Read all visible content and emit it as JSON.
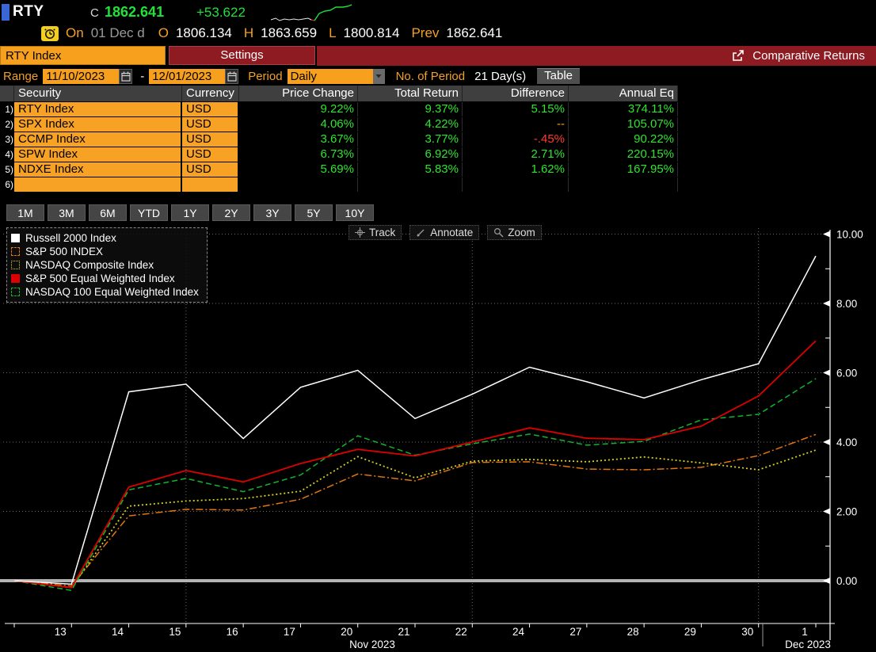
{
  "header": {
    "ticker": "RTY",
    "close_label": "C",
    "close_value": "1862.641",
    "change": "+53.622",
    "session_label": "On",
    "session_date": "01 Dec d",
    "open_label": "O",
    "open_value": "1806.134",
    "high_label": "H",
    "high_value": "1863.659",
    "low_label": "L",
    "low_value": "1800.814",
    "prev_label": "Prev",
    "prev_value": "1862.641"
  },
  "tabs": {
    "security_input": "RTY Index",
    "settings_label": "Settings",
    "title": "Comparative Returns"
  },
  "controls": {
    "range_label": "Range",
    "range_start": "11/10/2023",
    "range_separator": "-",
    "range_end": "12/01/2023",
    "period_label": "Period",
    "period_value": "Daily",
    "num_period_label": "No. of Period",
    "num_period_value": "21 Day(s)",
    "table_button": "Table"
  },
  "table": {
    "columns": [
      "Security",
      "Currency",
      "Price Change",
      "Total Return",
      "Difference",
      "Annual Eq"
    ],
    "rows": [
      {
        "num": "1)",
        "security": "RTY Index",
        "currency": "USD",
        "price_change": "9.22%",
        "total_return": "9.37%",
        "difference": "5.15%",
        "diff_color": "green",
        "annual_eq": "374.11%"
      },
      {
        "num": "2)",
        "security": "SPX Index",
        "currency": "USD",
        "price_change": "4.06%",
        "total_return": "4.22%",
        "difference": "--",
        "diff_color": "amber",
        "annual_eq": "105.07%"
      },
      {
        "num": "3)",
        "security": "CCMP Index",
        "currency": "USD",
        "price_change": "3.67%",
        "total_return": "3.77%",
        "difference": "-.45%",
        "diff_color": "red",
        "annual_eq": "90.22%"
      },
      {
        "num": "4)",
        "security": "SPW Index",
        "currency": "USD",
        "price_change": "6.73%",
        "total_return": "6.92%",
        "difference": "2.71%",
        "diff_color": "green",
        "annual_eq": "220.15%"
      },
      {
        "num": "5)",
        "security": "NDXE Index",
        "currency": "USD",
        "price_change": "5.69%",
        "total_return": "5.83%",
        "difference": "1.62%",
        "diff_color": "green",
        "annual_eq": "167.95%"
      },
      {
        "num": "6)",
        "security": "",
        "currency": "",
        "price_change": "",
        "total_return": "",
        "difference": "",
        "diff_color": "green",
        "annual_eq": ""
      }
    ]
  },
  "period_buttons": [
    "1M",
    "3M",
    "6M",
    "YTD",
    "1Y",
    "2Y",
    "3Y",
    "5Y",
    "10Y"
  ],
  "chart_toolbar": {
    "track_label": "Track",
    "annotate_label": "Annotate",
    "zoom_label": "Zoom"
  },
  "chart_data": {
    "type": "line",
    "title": "Comparative Returns (cumulative total return %, 11/10/2023 - 12/01/2023)",
    "x_dates": [
      "11/10",
      "11/13",
      "11/14",
      "11/15",
      "11/16",
      "11/17",
      "11/20",
      "11/21",
      "11/22",
      "11/24",
      "11/27",
      "11/28",
      "11/29",
      "11/30",
      "12/01"
    ],
    "x_tick_labels": [
      "13",
      "14",
      "15",
      "16",
      "17",
      "20",
      "21",
      "22",
      "24",
      "27",
      "28",
      "29",
      "30",
      "1"
    ],
    "month_labels": [
      "Nov 2023",
      "Dec 2023"
    ],
    "y_ticks": [
      0,
      2,
      4,
      6,
      8,
      10
    ],
    "y_tick_labels": [
      "0.00",
      "2.00",
      "4.00",
      "6.00",
      "8.00",
      "10.00"
    ],
    "ylim": [
      -0.75,
      10.35
    ],
    "grid": "dotted",
    "legend_position": "top-left",
    "series": [
      {
        "name": "Russell 2000 Index",
        "color": "#ffffff",
        "style": "solid",
        "values": [
          0,
          -0.1,
          5.45,
          5.67,
          4.1,
          5.58,
          6.07,
          4.68,
          5.38,
          6.16,
          5.74,
          5.27,
          5.8,
          6.26,
          9.37
        ]
      },
      {
        "name": "S&P 500 INDEX",
        "color": "#e2750f",
        "style": "dashdot",
        "values": [
          0,
          -0.15,
          1.87,
          2.06,
          2.04,
          2.35,
          3.08,
          2.88,
          3.41,
          3.43,
          3.22,
          3.2,
          3.27,
          3.61,
          4.22
        ]
      },
      {
        "name": "NASDAQ Composite Index",
        "color": "#d6cf1c",
        "style": "dotted",
        "values": [
          0,
          -0.2,
          2.15,
          2.3,
          2.37,
          2.58,
          3.58,
          2.97,
          3.45,
          3.5,
          3.43,
          3.57,
          3.4,
          3.2,
          3.77
        ]
      },
      {
        "name": "S&P 500 Equal Weighted Index",
        "color": "#dd0000",
        "style": "solid",
        "values": [
          0,
          -0.2,
          2.7,
          3.18,
          2.85,
          3.38,
          3.79,
          3.6,
          4.0,
          4.41,
          4.11,
          4.07,
          4.46,
          5.33,
          6.92
        ]
      },
      {
        "name": "NASDAQ 100 Equal Weighted Index",
        "color": "#0eb52e",
        "style": "dashed",
        "values": [
          0,
          -0.28,
          2.62,
          2.95,
          2.57,
          3.05,
          4.18,
          3.62,
          3.95,
          4.23,
          3.91,
          4.02,
          4.64,
          4.8,
          5.83
        ]
      }
    ]
  },
  "colors": {
    "accent_amber": "#f7a01e",
    "panel_red": "#8e1a22",
    "positive_green": "#2fe32f",
    "negative_red": "#ff3b30",
    "label_amber": "#f59f23"
  }
}
